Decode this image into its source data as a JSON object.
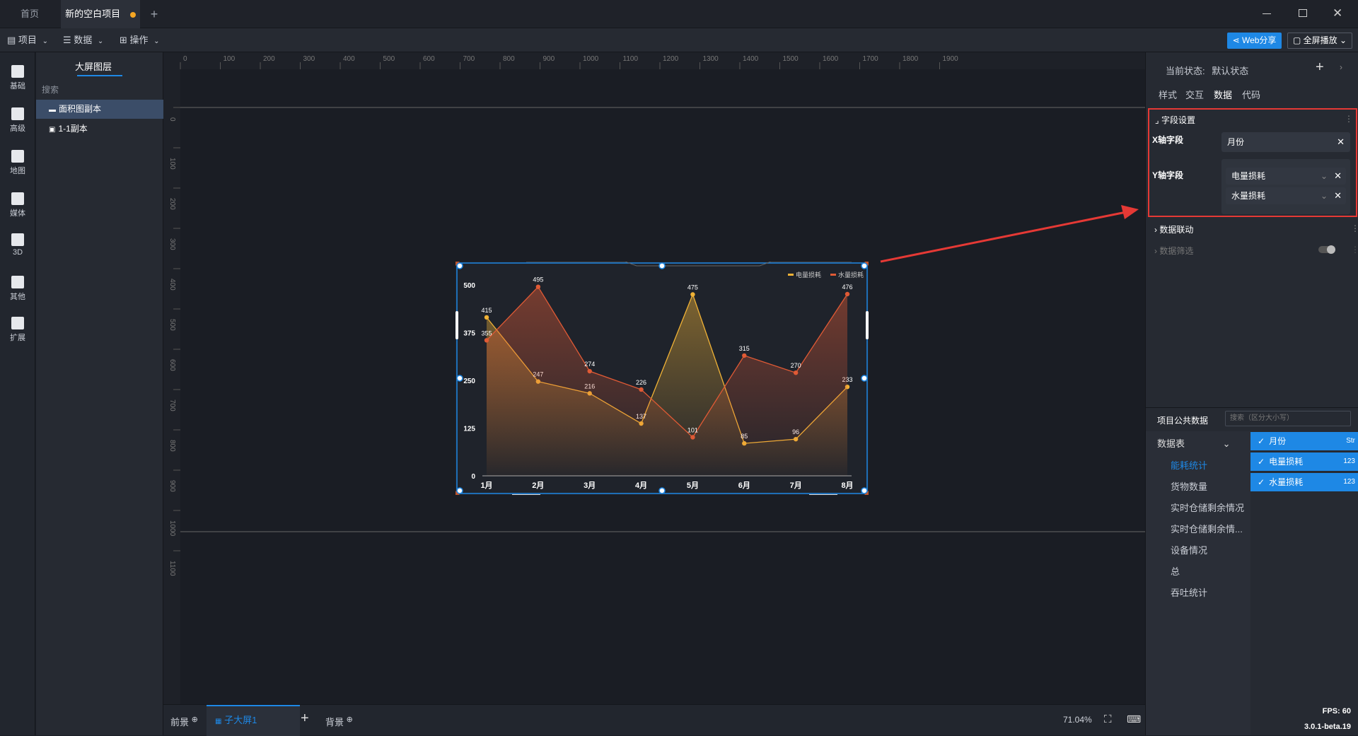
{
  "titlebar": {
    "tabs": [
      "首页",
      "新的空白项目"
    ],
    "add_tab": "+"
  },
  "toolbar": {
    "menus": [
      "项目",
      "数据",
      "操作"
    ],
    "web_share": "Web分享",
    "fullscreen": "全屏播放"
  },
  "leftnav": [
    "基础",
    "高级",
    "地图",
    "媒体",
    "3D",
    "其他",
    "扩展"
  ],
  "layers": {
    "title": "大屏图层",
    "search_placeholder": "搜索",
    "items": [
      "面积图副本",
      "1-1副本"
    ]
  },
  "ruler": {
    "h_ticks": [
      "0",
      "100",
      "200",
      "300",
      "400",
      "500",
      "600",
      "700",
      "800",
      "900",
      "1000",
      "1100",
      "1200",
      "1300",
      "1400",
      "1500",
      "1600",
      "1700",
      "1800",
      "1900"
    ],
    "v_ticks": [
      "0",
      "100",
      "200",
      "300",
      "400",
      "500",
      "600",
      "700",
      "800",
      "900",
      "1000",
      "1100"
    ]
  },
  "chart_data": {
    "type": "area",
    "categories": [
      "1月",
      "2月",
      "3月",
      "4月",
      "5月",
      "6月",
      "7月",
      "8月"
    ],
    "series": [
      {
        "name": "电量损耗",
        "values": [
          415,
          247,
          216,
          137,
          475,
          85,
          96,
          233
        ],
        "color": "#f0b236"
      },
      {
        "name": "水量损耗",
        "values": [
          355,
          495,
          274,
          226,
          101,
          315,
          270,
          476
        ],
        "color": "#e05a35"
      }
    ],
    "yticks": [
      "0",
      "125",
      "250",
      "375",
      "500"
    ],
    "ylim": [
      0,
      500
    ],
    "legend_position": "top-right"
  },
  "bottombar": {
    "foreground": "前景",
    "screen_tab": "子大屏1",
    "add": "+",
    "background": "背景",
    "zoom": "71.04%"
  },
  "rightpanel": {
    "state_label": "当前状态:",
    "state_value": "默认状态",
    "tabs": [
      "样式",
      "交互",
      "数据",
      "代码"
    ],
    "field_settings": "字段设置",
    "x_field_label": "X轴字段",
    "x_field_value": "月份",
    "y_field_label": "Y轴字段",
    "y_field_values": [
      "电量损耗",
      "水量损耗"
    ],
    "data_link": "数据联动",
    "data_filter": "数据筛选",
    "public_data_title": "项目公共数据",
    "search_placeholder": "搜索（区分大小写）",
    "datatable_label": "数据表",
    "tables": [
      "能耗统计",
      "货物数量",
      "实时仓储剩余情况",
      "实时仓储剩余情...",
      "设备情况",
      "总",
      "吞吐统计"
    ],
    "columns": [
      {
        "name": "月份",
        "type": "Str"
      },
      {
        "name": "电量损耗",
        "type": "123"
      },
      {
        "name": "水量损耗",
        "type": "123"
      }
    ],
    "fps": "FPS: 60",
    "version": "3.0.1-beta.19"
  }
}
